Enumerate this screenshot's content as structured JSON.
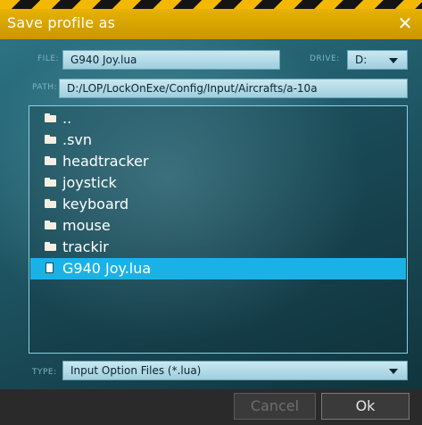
{
  "dialog": {
    "title": "Save profile as",
    "close_icon": "close-icon"
  },
  "file": {
    "label": "FILE:",
    "value": "G940 Joy.lua"
  },
  "drive": {
    "label": "DRIVE:",
    "value": "D:"
  },
  "path": {
    "label": "PATH:",
    "value": "D:/LOP/LockOnExe/Config/Input/Aircrafts/a-10a"
  },
  "list": {
    "items": [
      {
        "name": "..",
        "icon": "folder-icon"
      },
      {
        "name": ".svn",
        "icon": "folder-icon"
      },
      {
        "name": "headtracker",
        "icon": "folder-icon"
      },
      {
        "name": "joystick",
        "icon": "folder-icon"
      },
      {
        "name": "keyboard",
        "icon": "folder-icon"
      },
      {
        "name": "mouse",
        "icon": "folder-icon"
      },
      {
        "name": "trackir",
        "icon": "folder-icon"
      },
      {
        "name": "G940 Joy.lua",
        "icon": "file-icon",
        "selected": true
      }
    ]
  },
  "type": {
    "label": "TYPE:",
    "value": "Input Option Files (*.lua)"
  },
  "buttons": {
    "cancel": "Cancel",
    "ok": "Ok"
  },
  "colors": {
    "accent": "#e7b200",
    "selection": "#1ab2e6"
  }
}
